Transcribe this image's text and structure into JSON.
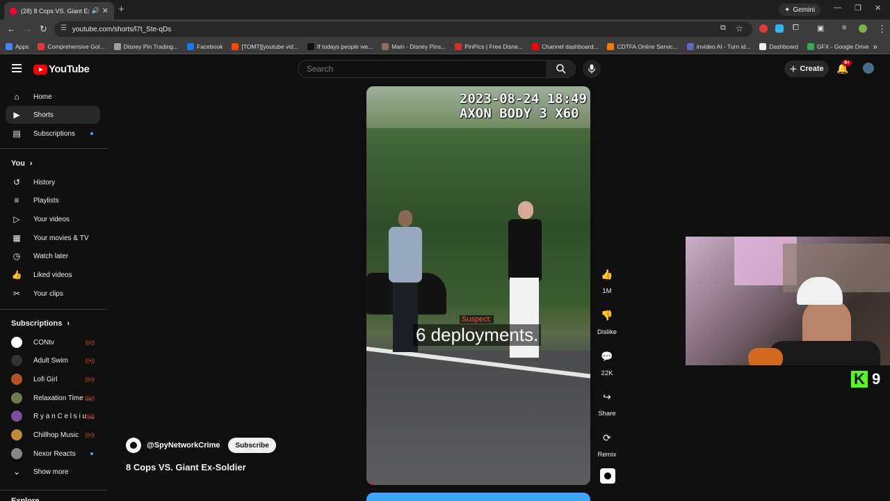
{
  "browser": {
    "tab_title": "(28) 8 Cops VS. Giant Ex-Sol",
    "url": "youtube.com/shorts/l7t_Ste-qDs",
    "gemini_label": "Gemini",
    "bookmarks": [
      {
        "label": "Apps",
        "color": "#4285f4"
      },
      {
        "label": "Comprehensive Gol...",
        "color": "#e53935"
      },
      {
        "label": "Disney Pin Trading...",
        "color": "#9e9e9e"
      },
      {
        "label": "Facebook",
        "color": "#1877f2"
      },
      {
        "label": "[TOMT][youtube vid...",
        "color": "#ff4500"
      },
      {
        "label": "If todays people we...",
        "color": "#111111"
      },
      {
        "label": "Main - Disney Pins...",
        "color": "#8d6e63"
      },
      {
        "label": "PinPics | Free Disne...",
        "color": "#d32f2f"
      },
      {
        "label": "Channel dashboard...",
        "color": "#ff0000"
      },
      {
        "label": "CDTFA Online Servic...",
        "color": "#f57c00"
      },
      {
        "label": "invideo AI - Turn id...",
        "color": "#5c6bc0"
      },
      {
        "label": "Dashboard",
        "color": "#eeeeee"
      },
      {
        "label": "GFX - Google Drive",
        "color": "#34a853"
      }
    ]
  },
  "masthead": {
    "logo_text": "YouTube",
    "search_placeholder": "Search",
    "create_label": "Create",
    "notif_badge": "9+"
  },
  "sidebar": {
    "main": [
      {
        "label": "Home",
        "icon": "home-icon",
        "glyph": "⌂"
      },
      {
        "label": "Shorts",
        "icon": "shorts-icon",
        "glyph": "▶"
      },
      {
        "label": "Subscriptions",
        "icon": "subscriptions-icon",
        "glyph": "▤"
      }
    ],
    "you_header": "You",
    "you": [
      {
        "label": "History",
        "icon": "history-icon",
        "glyph": "↺"
      },
      {
        "label": "Playlists",
        "icon": "playlists-icon",
        "glyph": "≡"
      },
      {
        "label": "Your videos",
        "icon": "your-videos-icon",
        "glyph": "▷"
      },
      {
        "label": "Your movies & TV",
        "icon": "movies-icon",
        "glyph": "▦"
      },
      {
        "label": "Watch later",
        "icon": "clock-icon",
        "glyph": "◷"
      },
      {
        "label": "Liked videos",
        "icon": "thumbs-up-icon",
        "glyph": "👍"
      },
      {
        "label": "Your clips",
        "icon": "scissors-icon",
        "glyph": "✂"
      }
    ],
    "subs_header": "Subscriptions",
    "subs": [
      {
        "label": "CONtv",
        "color": "#ffffff",
        "status": "live"
      },
      {
        "label": "Adult Swim",
        "color": "#333333",
        "status": "live"
      },
      {
        "label": "Lofi Girl",
        "color": "#b3541e",
        "status": "live"
      },
      {
        "label": "Relaxation Time ...",
        "color": "#6b7b4f",
        "status": "live"
      },
      {
        "label": "R y a n C e l s i u ...",
        "color": "#7a4fa0",
        "status": "live"
      },
      {
        "label": "Chillhop Music",
        "color": "#c48a3a",
        "status": "live"
      },
      {
        "label": "Nexor Reacts",
        "color": "#888888",
        "status": "dot"
      }
    ],
    "show_more": "Show more",
    "explore_header": "Explore"
  },
  "short": {
    "stamp_line1": "2023-08-24 18:49",
    "stamp_line2": "AXON BODY 3 X60",
    "speaker_label": "Suspect:",
    "caption": "6 deployments.",
    "progress": 0.03,
    "channel": "@SpyNetworkCrime",
    "subscribe_label": "Subscribe",
    "title": "8 Cops VS. Giant Ex-Soldier"
  },
  "actions": {
    "like_count": "1M",
    "dislike_label": "Dislike",
    "comment_count": "22K",
    "share_label": "Share",
    "remix_label": "Remix"
  },
  "overlay": {
    "kick_count": "9"
  }
}
